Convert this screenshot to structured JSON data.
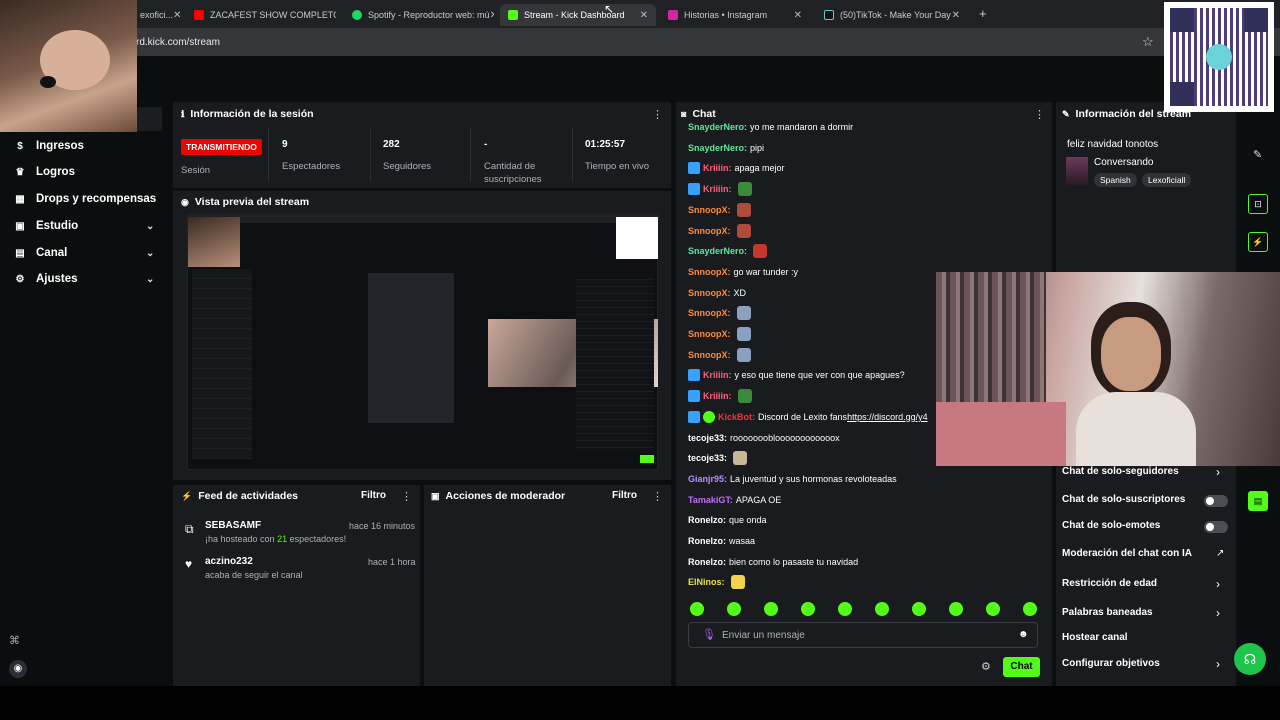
{
  "browser": {
    "tabs": [
      {
        "label": "exofici...",
        "active": false
      },
      {
        "label": "ZACAFEST SHOW COMPLETO",
        "active": false
      },
      {
        "label": "Spotify - Reproductor web: mú",
        "active": false
      },
      {
        "label": "Stream - Kick Dashboard",
        "active": true
      },
      {
        "label": "Historias • Instagram",
        "active": false
      },
      {
        "label": "(50)TikTok - Make Your Day",
        "active": false
      }
    ],
    "new_tab": "+",
    "url": "rd.kick.com/stream"
  },
  "sidebar": {
    "items": [
      {
        "label": "Ingresos",
        "icon": "dollar-icon"
      },
      {
        "label": "Logros",
        "icon": "trophy-icon"
      },
      {
        "label": "Drops y recompensas",
        "icon": "gift-icon"
      },
      {
        "label": "Estudio",
        "icon": "studio-icon",
        "expandable": true
      },
      {
        "label": "Canal",
        "icon": "channel-icon",
        "expandable": true
      },
      {
        "label": "Ajustes",
        "icon": "gear-icon",
        "expandable": true
      }
    ]
  },
  "session": {
    "title": "Información de la sesión",
    "live_badge": "TRANSMITIENDO",
    "session_label": "Sesión",
    "stats": [
      {
        "value": "9",
        "label": "Espectadores"
      },
      {
        "value": "282",
        "label": "Seguidores"
      },
      {
        "value": "-",
        "label": "Cantidad de suscripciones"
      },
      {
        "value": "01:25:57",
        "label": "Tiempo en vivo"
      }
    ]
  },
  "preview": {
    "title": "Vista previa del stream"
  },
  "feed": {
    "title": "Feed de actividades",
    "filter": "Filtro",
    "items": [
      {
        "user": "SEBASAMF",
        "time": "hace 16 minutos",
        "text_pre": "¡ha hosteado con ",
        "count": "21",
        "text_post": " espectadores!",
        "icon": "host-icon"
      },
      {
        "user": "aczino232",
        "time": "hace 1 hora",
        "text": "acaba de seguir el canal",
        "icon": "heart-icon"
      }
    ]
  },
  "moderator": {
    "title": "Acciones de moderador",
    "filter": "Filtro"
  },
  "chat": {
    "title": "Chat",
    "messages": [
      {
        "user": "SnayderNero:",
        "color": "#5ee89a",
        "text": "yo me mandaron a dormir"
      },
      {
        "user": "SnayderNero:",
        "color": "#5ee89a",
        "text": "pipi"
      },
      {
        "user": "Kriiiin:",
        "color": "#ff5e7a",
        "text": "apaga mejor",
        "badge": true
      },
      {
        "user": "Kriiiin:",
        "color": "#ff5e7a",
        "text": "",
        "emote": "#3a8a3a",
        "badge": true
      },
      {
        "user": "SnnoopX:",
        "color": "#ff8a3d",
        "text": "",
        "emote": "#b04a3a"
      },
      {
        "user": "SnnoopX:",
        "color": "#ff8a3d",
        "text": "",
        "emote": "#b04a3a"
      },
      {
        "user": "SnayderNero:",
        "color": "#5ee89a",
        "text": "",
        "emote": "#c0392b"
      },
      {
        "user": "SnnoopX:",
        "color": "#ff8a3d",
        "text": "go war tunder :y"
      },
      {
        "user": "SnnoopX:",
        "color": "#ff8a3d",
        "text": "XD"
      },
      {
        "user": "SnnoopX:",
        "color": "#ff8a3d",
        "text": "",
        "emote": "#8aa0c0"
      },
      {
        "user": "SnnoopX:",
        "color": "#ff8a3d",
        "text": "",
        "emote": "#8aa0c0"
      },
      {
        "user": "SnnoopX:",
        "color": "#ff8a3d",
        "text": "",
        "emote": "#8aa0c0"
      },
      {
        "user": "Kriiiin:",
        "color": "#ff5e7a",
        "text": "y eso que tiene que ver con que apagues?",
        "badge": true
      },
      {
        "user": "Kriiiin:",
        "color": "#ff5e7a",
        "text": "",
        "emote": "#3a8a3a",
        "badge": true
      },
      {
        "user": "KickBot:",
        "color": "#e63b3b",
        "text": "Discord de Lexito fans ",
        "link": "https://discord.gg/y4",
        "badge": true,
        "badge2": true
      },
      {
        "user": "tecoje33:",
        "color": "#ffffff",
        "text": "rooooooobloooooooooooox"
      },
      {
        "user": "tecoje33:",
        "color": "#ffffff",
        "text": "",
        "emote": "#c9b79a"
      },
      {
        "user": "Gianjr95:",
        "color": "#b98cff",
        "text": "La juventud y sus hormonas revoloteadas"
      },
      {
        "user": "TamakiGT:",
        "color": "#c06cff",
        "text": "APAGA OE"
      },
      {
        "user": "Ronelzo:",
        "color": "#ffffff",
        "text": "que onda"
      },
      {
        "user": "Ronelzo:",
        "color": "#ffffff",
        "text": "wasaa"
      },
      {
        "user": "Ronelzo:",
        "color": "#ffffff",
        "text": "bien como lo pasaste tu navidad"
      },
      {
        "user": "ElNinos:",
        "color": "#e6e24a",
        "text": "",
        "emote": "#f2d34a"
      }
    ],
    "input_placeholder": "Enviar un mensaje",
    "send_label": "Chat"
  },
  "stream_info": {
    "title": "Información del stream",
    "stream_title": "feliz navidad tonotos",
    "category": "Conversando",
    "tags": [
      "Spanish",
      "Lexoficiall"
    ]
  },
  "chat_settings": [
    {
      "label": "Chat de solo-seguidores",
      "control": "chevron"
    },
    {
      "label": "Chat de solo-suscriptores",
      "control": "toggle"
    },
    {
      "label": "Chat de solo-emotes",
      "control": "toggle"
    },
    {
      "label": "Moderación del chat con IA",
      "control": "external"
    },
    {
      "label": "Restricción de edad",
      "control": "chevron"
    },
    {
      "label": "Palabras baneadas",
      "control": "chevron"
    },
    {
      "label": "Hostear canal",
      "control": "none"
    },
    {
      "label": "Configurar objetivos",
      "control": "chevron"
    }
  ],
  "colors": {
    "accent": "#53fc18",
    "live": "#eb0400",
    "panel": "#191b1f",
    "bg": "#0b0e0f"
  }
}
